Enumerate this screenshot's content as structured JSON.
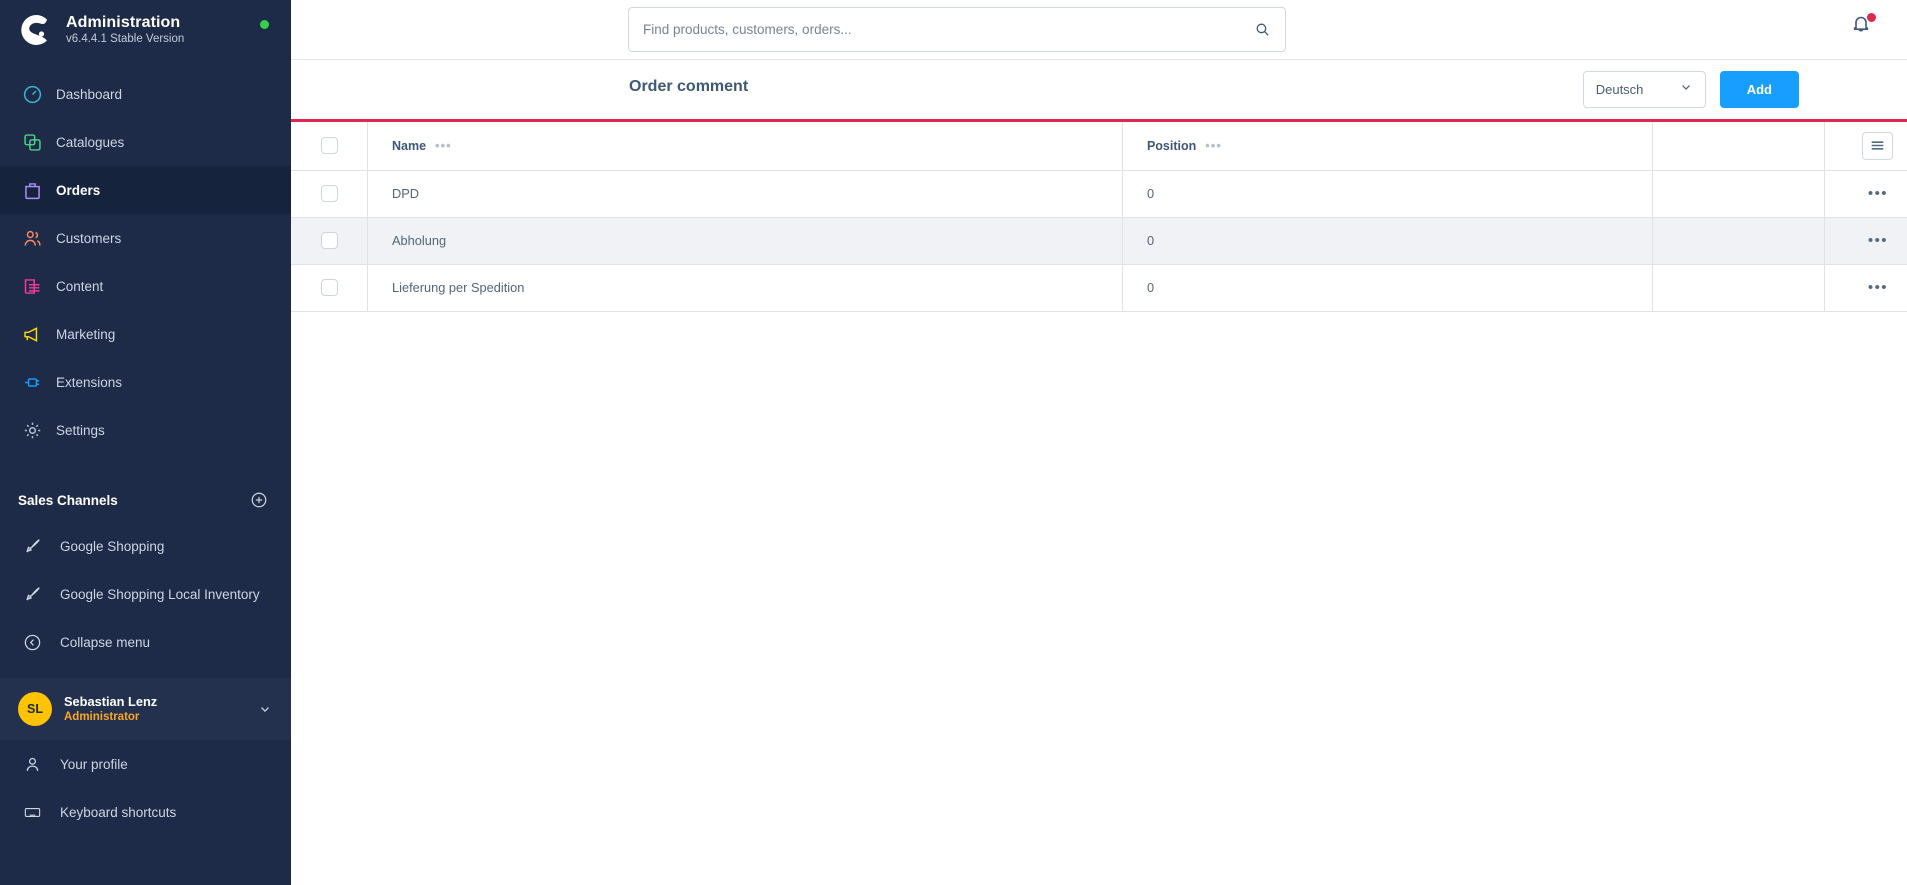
{
  "brand": {
    "title": "Administration",
    "version": "v6.4.4.1 Stable Version",
    "logo_icon": "shopware-logo-icon",
    "status_icon": "status-online-dot"
  },
  "sidebar": {
    "items": [
      {
        "label": "Dashboard",
        "icon": "dashboard-icon",
        "color": "#37b6ce",
        "active": false
      },
      {
        "label": "Catalogues",
        "icon": "catalogues-icon",
        "color": "#4dd181",
        "active": false
      },
      {
        "label": "Orders",
        "icon": "orders-icon",
        "color": "#b08df7",
        "active": true
      },
      {
        "label": "Customers",
        "icon": "customers-icon",
        "color": "#f88962",
        "active": false
      },
      {
        "label": "Content",
        "icon": "content-icon",
        "color": "#f5399b",
        "active": false
      },
      {
        "label": "Marketing",
        "icon": "marketing-icon",
        "color": "#ffd500",
        "active": false
      },
      {
        "label": "Extensions",
        "icon": "extensions-icon",
        "color": "#1a9bfa",
        "active": false
      },
      {
        "label": "Settings",
        "icon": "settings-gear-icon",
        "color": "#b9c2cc",
        "active": false
      }
    ],
    "sales_channels": {
      "title": "Sales Channels",
      "add_icon": "plus-circle-icon",
      "items": [
        {
          "label": "Google Shopping",
          "icon": "rocket-icon"
        },
        {
          "label": "Google Shopping Local Inventory",
          "icon": "rocket-icon"
        }
      ]
    },
    "collapse": {
      "label": "Collapse menu",
      "icon": "chevron-left-circle-icon"
    },
    "user": {
      "initials": "SL",
      "name": "Sebastian Lenz",
      "role": "Administrator",
      "caret_icon": "chevron-down-icon",
      "avatar_color": "#ffc300"
    },
    "footer_items": [
      {
        "label": "Your profile",
        "icon": "user-icon"
      },
      {
        "label": "Keyboard shortcuts",
        "icon": "keyboard-icon"
      }
    ]
  },
  "topbar": {
    "search": {
      "placeholder": "Find products, customers, orders...",
      "value": "",
      "icon": "search-icon"
    },
    "notifications": {
      "icon": "bell-icon",
      "has_unread": true,
      "dot_color": "#de294c"
    }
  },
  "page": {
    "title": "Order comment",
    "language": {
      "value": "Deutsch",
      "caret_icon": "chevron-down-icon"
    },
    "add_label": "Add",
    "accent_color": "#189eff",
    "progress_color": "#de294c"
  },
  "table": {
    "columns": [
      {
        "key": "select",
        "label": "",
        "dots": false
      },
      {
        "key": "name",
        "label": "Name",
        "dots": true
      },
      {
        "key": "position",
        "label": "Position",
        "dots": true
      },
      {
        "key": "blank",
        "label": "",
        "dots": false
      },
      {
        "key": "actions",
        "label": "",
        "dots": false
      }
    ],
    "settings_icon": "list-settings-icon",
    "row_menu_icon": "context-menu-dots-icon",
    "rows": [
      {
        "name": "DPD",
        "position": "0",
        "hover": false
      },
      {
        "name": "Abholung",
        "position": "0",
        "hover": true
      },
      {
        "name": "Lieferung per Spedition",
        "position": "0",
        "hover": false
      }
    ]
  }
}
